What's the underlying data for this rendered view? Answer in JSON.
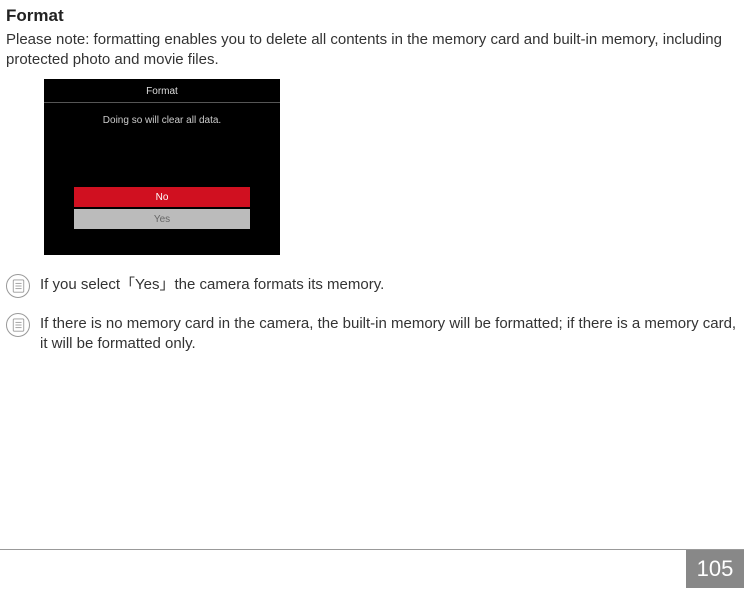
{
  "title": "Format",
  "intro": "Please note: formatting enables you to delete all contents in the memory card and built-in memory, including protected photo and movie files.",
  "camera_screen": {
    "title": "Format",
    "message": "Doing so will clear all data.",
    "no_label": "No",
    "yes_label": "Yes"
  },
  "notes": [
    {
      "text": "If you select「Yes」the camera formats its memory."
    },
    {
      "text": "If there is no memory card in the camera, the built-in memory will be formatted; if there is a memory card, it will be formatted only."
    }
  ],
  "page_number": "105"
}
